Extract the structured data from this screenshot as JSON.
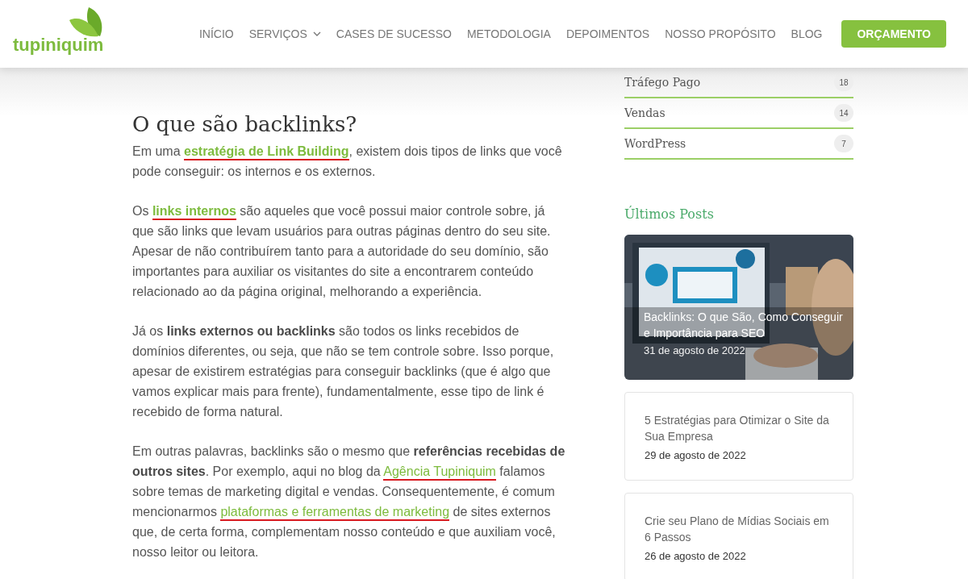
{
  "header": {
    "logo": "tupiniquim",
    "nav": [
      {
        "label": "INÍCIO",
        "dropdown": false
      },
      {
        "label": "SERVIÇOS",
        "dropdown": true
      },
      {
        "label": "CASES DE SUCESSO",
        "dropdown": false
      },
      {
        "label": "METODOLOGIA",
        "dropdown": false
      },
      {
        "label": "DEPOIMENTOS",
        "dropdown": false
      },
      {
        "label": "NOSSO PROPÓSITO",
        "dropdown": false
      },
      {
        "label": "BLOG",
        "dropdown": false
      }
    ],
    "cta": "ORÇAMENTO"
  },
  "article": {
    "heading": "O que são backlinks?",
    "paragraphs": [
      [
        {
          "kind": "text",
          "text": "Em uma "
        },
        {
          "kind": "link",
          "text": "estratégia de Link Building",
          "bold": true,
          "marked": true
        },
        {
          "kind": "text",
          "text": ", existem dois tipos de links que você pode conseguir: os internos e os externos."
        }
      ],
      [
        {
          "kind": "text",
          "text": "Os "
        },
        {
          "kind": "link",
          "text": "links internos",
          "bold": true,
          "marked": true
        },
        {
          "kind": "text",
          "text": " são aqueles que você possui maior controle sobre, já que são links que levam usuários para outras páginas dentro do seu site. Apesar de não contribuírem tanto para a autoridade do seu domínio, são importantes para auxiliar os visitantes do site a encontrarem conteúdo relacionado ao da página original, melhorando a experiência."
        }
      ],
      [
        {
          "kind": "text",
          "text": "Já os "
        },
        {
          "kind": "bold",
          "text": "links externos ou backlinks"
        },
        {
          "kind": "text",
          "text": " são todos os links recebidos de domínios diferentes, ou seja, que não se tem controle sobre. Isso porque, apesar de existirem estratégias para conseguir backlinks (que é algo que vamos explicar mais para frente), fundamentalmente, esse tipo de link é recebido de forma natural."
        }
      ],
      [
        {
          "kind": "text",
          "text": "Em outras palavras, backlinks são o mesmo que "
        },
        {
          "kind": "bold",
          "text": "referências recebidas de outros sites"
        },
        {
          "kind": "text",
          "text": ". Por exemplo, aqui no blog da "
        },
        {
          "kind": "link",
          "text": "Agência Tupiniquim",
          "bold": false,
          "marked": true
        },
        {
          "kind": "text",
          "text": " falamos sobre temas de marketing digital e vendas. Consequentemente, é comum mencionarmos "
        },
        {
          "kind": "link",
          "text": "plataformas e ferramentas de marketing",
          "bold": false,
          "marked": true
        },
        {
          "kind": "text",
          "text": " de sites externos que, de certa forma, complementam nosso conteúdo e que auxiliam você, nosso leitor ou leitora."
        }
      ]
    ]
  },
  "sidebar": {
    "categories": [
      {
        "name": "Tráfego Pago",
        "count": "18"
      },
      {
        "name": "Vendas",
        "count": "14"
      },
      {
        "name": "WordPress",
        "count": "7"
      }
    ],
    "latest_title": "Últimos Posts",
    "posts": [
      {
        "kind": "featured",
        "title": "Backlinks: O que São, Como Conseguir e Importância para SEO",
        "date": "31 de agosto de 2022"
      },
      {
        "kind": "card",
        "title": "5 Estratégias para Otimizar o Site da Sua Empresa",
        "date": "29 de agosto de 2022"
      },
      {
        "kind": "card",
        "title": "Crie seu Plano de Mídias Sociais em 6 Passos",
        "date": "26 de agosto de 2022"
      }
    ]
  }
}
